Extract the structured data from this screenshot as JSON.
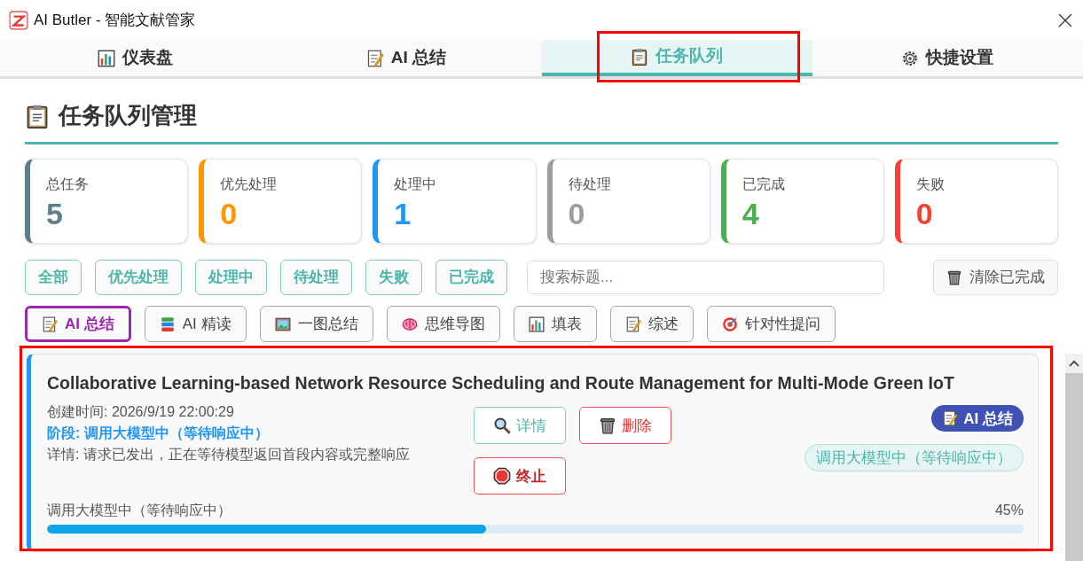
{
  "window": {
    "title": "AI Butler - 智能文献管家"
  },
  "tabs": [
    {
      "label": "仪表盘",
      "selected": false
    },
    {
      "label": "AI 总结",
      "selected": false
    },
    {
      "label": "任务队列",
      "selected": true
    },
    {
      "label": "快捷设置",
      "selected": false
    }
  ],
  "heading": {
    "label": "任务队列管理"
  },
  "stats": [
    {
      "label": "总任务",
      "value": "5",
      "color": "#607d8b"
    },
    {
      "label": "优先处理",
      "value": "0",
      "color": "#ff9800"
    },
    {
      "label": "处理中",
      "value": "1",
      "color": "#2196f3"
    },
    {
      "label": "待处理",
      "value": "0",
      "color": "#9e9e9e"
    },
    {
      "label": "已完成",
      "value": "4",
      "color": "#4caf50"
    },
    {
      "label": "失败",
      "value": "0",
      "color": "#f44336"
    }
  ],
  "filters": [
    {
      "label": "全部"
    },
    {
      "label": "优先处理"
    },
    {
      "label": "处理中"
    },
    {
      "label": "待处理"
    },
    {
      "label": "失败"
    },
    {
      "label": "已完成"
    }
  ],
  "search": {
    "placeholder": "搜索标题..."
  },
  "clear_button": {
    "label": "清除已完成"
  },
  "types": [
    {
      "label": "AI 总结",
      "selected": true
    },
    {
      "label": "AI 精读",
      "selected": false
    },
    {
      "label": "一图总结",
      "selected": false
    },
    {
      "label": "思维导图",
      "selected": false
    },
    {
      "label": "填表",
      "selected": false
    },
    {
      "label": "综述",
      "selected": false
    },
    {
      "label": "针对性提问",
      "selected": false
    }
  ],
  "tasks": [
    {
      "title": "Collaborative Learning-based Network Resource Scheduling and Route Management for Multi-Mode Green IoT",
      "created": "创建时间: 2026/9/19 22:00:29",
      "stage": "阶段: 调用大模型中（等待响应中）",
      "detail": "详情: 请求已发出，正在等待模型返回首段内容或完整响应",
      "buttons": [
        {
          "label": "详情",
          "kind": "detail"
        },
        {
          "label": "删除",
          "kind": "delete"
        },
        {
          "label": "终止",
          "kind": "stop"
        }
      ],
      "type_badge": {
        "label": "AI 总结"
      },
      "status": "调用大模型中（等待响应中）",
      "progress_label": "调用大模型中（等待响应中）",
      "progress_reading": "45%",
      "level": 0.45
    }
  ]
}
